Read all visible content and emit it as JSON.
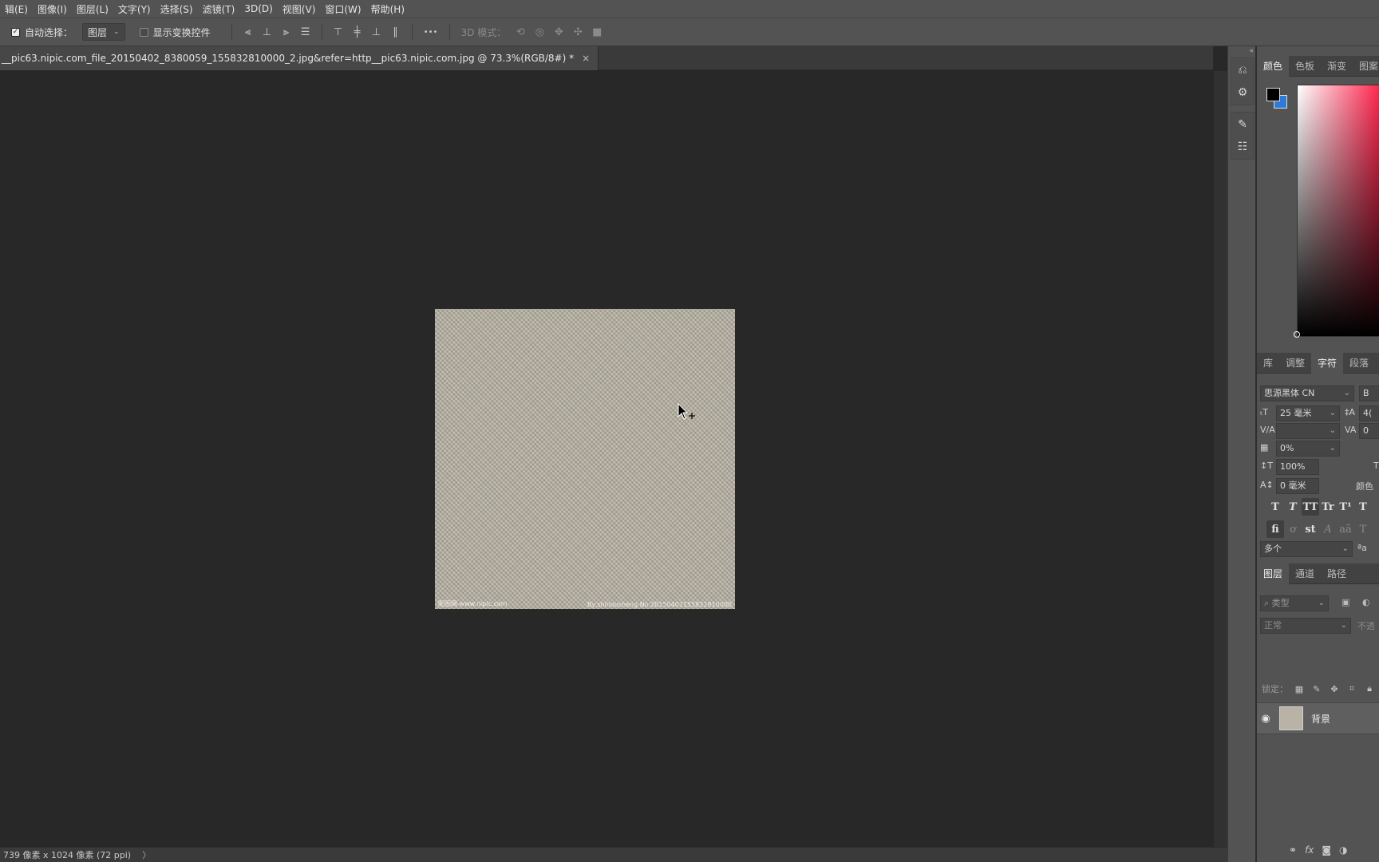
{
  "menu": [
    "辑(E)",
    "图像(I)",
    "图层(L)",
    "文字(Y)",
    "选择(S)",
    "滤镜(T)",
    "3D(D)",
    "视图(V)",
    "窗口(W)",
    "帮助(H)"
  ],
  "options": {
    "auto_select_label": "自动选择：",
    "auto_select_target": "图层",
    "show_transform_label": "显示变换控件",
    "more_glyph": "•••",
    "mode_3d_label": "3D 模式："
  },
  "document": {
    "tab_title": "__pic63.nipic.com_file_20150402_8380059_155832810000_2.jpg&refer=http__pic63.nipic.com.jpg @ 73.3%(RGB/8#) *",
    "close_glyph": "×",
    "watermark_left": "昵图网 www.nipic.com",
    "watermark_right": "By:shihousheng No:20150402155832810000"
  },
  "status": {
    "info": "739 像素 x 1024 像素 (72 ppi)",
    "arrow": "〉"
  },
  "color_panel": {
    "tabs": [
      "颜色",
      "色板",
      "渐变",
      "图案"
    ],
    "foreground": "#000000",
    "background": "#2d7bd6"
  },
  "character_panel": {
    "tabs": [
      "库",
      "调整",
      "字符",
      "段落"
    ],
    "font_family": "思源黑体 CN",
    "font_style_abbrev": "B",
    "font_size": "25 毫米",
    "leading_abbrev": "4(",
    "kerning": "",
    "tracking_abbrev": "0",
    "tsume": "0%",
    "vertical_scale": "100%",
    "baseline_shift": "0 毫米",
    "color_label": "颜色",
    "language": "多个",
    "aa_glyph": "ªa",
    "style_row1": [
      "T",
      "T",
      "TT",
      "Tr",
      "T¹",
      "T"
    ],
    "style_row2": [
      "fi",
      "ơ",
      "st",
      "A",
      "aā",
      "T"
    ]
  },
  "layers_panel": {
    "tabs": [
      "图层",
      "通道",
      "路径"
    ],
    "filter_placeholder": "类型",
    "blend_mode": "正常",
    "opacity_label": "不透",
    "lock_label": "锁定：",
    "layers": [
      {
        "name": "背景",
        "visible": true
      }
    ]
  }
}
